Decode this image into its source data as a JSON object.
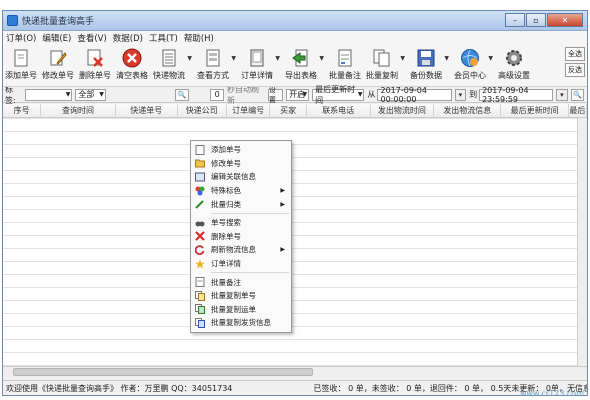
{
  "window": {
    "title": "快递批量查询高手"
  },
  "menu": [
    "订单(O)",
    "编辑(E)",
    "查看(V)",
    "数据(D)",
    "工具(T)",
    "帮助(H)"
  ],
  "toolbar": [
    {
      "label": "添加单号",
      "icon": "add-doc-icon",
      "arrow": false
    },
    {
      "label": "修改单号",
      "icon": "edit-pencil-icon",
      "arrow": false
    },
    {
      "label": "删除单号",
      "icon": "delete-doc-icon",
      "arrow": false
    },
    {
      "label": "清空表格",
      "icon": "clear-red-icon",
      "arrow": false
    },
    {
      "label": "快递物流",
      "icon": "doc-list-icon",
      "arrow": true
    },
    {
      "label": "查看方式",
      "icon": "view-mode-icon",
      "arrow": true
    },
    {
      "label": "订单详情",
      "icon": "detail-icon",
      "arrow": true
    },
    {
      "label": "导出表格",
      "icon": "export-green-icon",
      "arrow": true
    },
    {
      "label": "批量备注",
      "icon": "note-icon",
      "arrow": false
    },
    {
      "label": "批量复制",
      "icon": "copy-icon",
      "arrow": true
    },
    {
      "label": "备份数据",
      "icon": "save-disk-icon",
      "arrow": true
    },
    {
      "label": "会员中心",
      "icon": "globe-user-icon",
      "arrow": true
    },
    {
      "label": "高级设置",
      "icon": "gear-icon",
      "arrow": false
    }
  ],
  "side_buttons": [
    "全选",
    "反选"
  ],
  "filter": {
    "label": "标签:",
    "tag_value": "",
    "status_value": "全部",
    "count": "0",
    "auto_refresh": "秒自动刷新",
    "settings_btn": "设置",
    "toggle": "开启",
    "time_type": "最后更新时间",
    "from_label": "从",
    "from_date": "2017-09-04 00:00:00",
    "to_label": "到",
    "to_date": "2017-09-04 23:59:59"
  },
  "columns": [
    "序号",
    "查询时间",
    "快递单号",
    "快递公司",
    "订单编号",
    "买家",
    "联系电话",
    "发出物流时间",
    "发出物流信息",
    "最后更新时间",
    "最后"
  ],
  "context_menu": [
    {
      "label": "添加单号",
      "icon": "doc-icon",
      "sub": false
    },
    {
      "label": "修改单号",
      "icon": "folder-icon",
      "sub": false
    },
    {
      "label": "编辑关联信息",
      "icon": "link-edit-icon",
      "sub": false
    },
    {
      "label": "特殊标色",
      "icon": "color-flag-icon",
      "sub": true
    },
    {
      "label": "批量归类",
      "icon": "tag-icon",
      "sub": true
    },
    "sep",
    {
      "label": "单号搜索",
      "icon": "binoculars-icon",
      "sub": false
    },
    {
      "label": "删除单号",
      "icon": "x-red-icon",
      "sub": false
    },
    {
      "label": "刷新物流信息",
      "icon": "refresh-icon",
      "sub": true
    },
    {
      "label": "订单详情",
      "icon": "star-icon",
      "sub": false
    },
    "sep",
    {
      "label": "批量备注",
      "icon": "note-icon",
      "sub": false
    },
    {
      "label": "批量复制单号",
      "icon": "copy-icon",
      "sub": false
    },
    {
      "label": "批量复制运单",
      "icon": "copy-green-icon",
      "sub": false
    },
    {
      "label": "批量复制发货信息",
      "icon": "copy-info-icon",
      "sub": false
    }
  ],
  "status": {
    "left": "欢迎使用《快递批量查询高手》 作者：万里鹏  QQ：34051734",
    "right": "已签收： 0 单，未签收： 0 单，退回件： 0 单， 0.5天未更新： 0单，无信息件："
  },
  "watermark": "www.cr173.com"
}
